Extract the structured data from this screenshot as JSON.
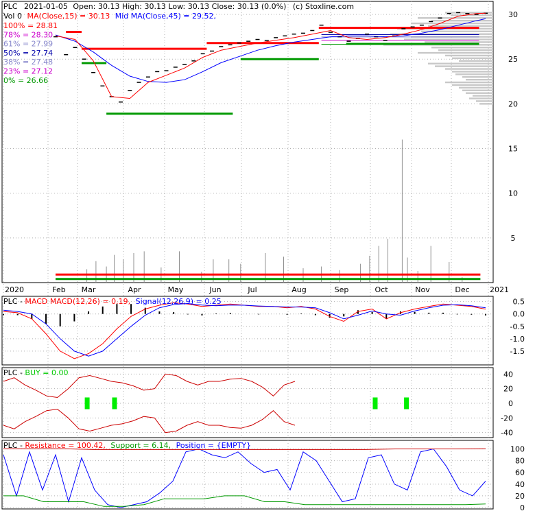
{
  "header": {
    "symbol": "PLC",
    "date": "2021-01-05",
    "ohlc_text": "Open: 30.13  High: 30.13  Low: 30.13  Close: 30.13 (0.0%)",
    "source": "(c) Stoxline.com"
  },
  "ma_legend": {
    "vol": "Vol 0",
    "ma15": "MA(Close,15) = 30.13",
    "ma45": "Mid MA(Close,45) = 29.52,"
  },
  "fib_levels": [
    {
      "label": "100% = 28.81",
      "color": "#ff0000"
    },
    {
      "label": "78% = 28.30",
      "color": "#cc00cc"
    },
    {
      "label": "61% = 27.99",
      "color": "#8888cc"
    },
    {
      "label": "50% = 27.74",
      "color": "#0000aa"
    },
    {
      "label": "38% = 27.48",
      "color": "#8888cc"
    },
    {
      "label": "23% = 27.12",
      "color": "#cc00cc"
    },
    {
      "label": "0% = 26.66",
      "color": "#009900"
    }
  ],
  "colors": {
    "price": "#000000",
    "ma15": "#ff0000",
    "ma45": "#0000ff",
    "resistance": "#ff0000",
    "support": "#009900",
    "volume": "#909090",
    "grid": "#b0b0b0"
  },
  "panels": {
    "macd": {
      "symbol": "PLC",
      "name": "MACD",
      "macd_label": "MACD(12,26) = 0.19,",
      "signal_label": "Signal(12,26,9) = 0.25"
    },
    "buy": {
      "symbol": "PLC",
      "label": "BUY = 0.00"
    },
    "rsp": {
      "symbol": "PLC",
      "resistance_label": "Resistance = 100.42,",
      "support_label": "Support = 6.14,",
      "position_label": "Position = {EMPTY}"
    }
  },
  "chart_data": [
    {
      "type": "line",
      "title": "PLC 2021-01-05 Open: 30.13 High: 30.13 Low: 30.13 Close: 30.13 (0.0%)",
      "x_ticks": [
        "2020",
        "Feb",
        "Mar",
        "Apr",
        "May",
        "Jun",
        "Jul",
        "Aug",
        "Sep",
        "Oct",
        "Nov",
        "Dec",
        "2021"
      ],
      "ylim": [
        0,
        31
      ],
      "y_ticks": [
        5,
        10,
        15,
        20,
        25,
        30
      ],
      "series": [
        {
          "name": "Close",
          "x": [
            "Feb 10",
            "Feb 18",
            "Feb 25",
            "Mar 3",
            "Mar 10",
            "Mar 17",
            "Mar 24",
            "Mar 31",
            "Apr 7",
            "Apr 14",
            "Apr 21",
            "Apr 28",
            "May 5",
            "May 12",
            "May 19",
            "May 26",
            "Jun 2",
            "Jun 9",
            "Jun 16",
            "Jun 23",
            "Jun 30",
            "Jul 7",
            "Jul 14",
            "Jul 21",
            "Jul 28",
            "Aug 4",
            "Aug 11",
            "Aug 18",
            "Aug 25",
            "Sep 1",
            "Sep 8",
            "Sep 15",
            "Sep 22",
            "Sep 29",
            "Oct 6",
            "Oct 13",
            "Oct 20",
            "Oct 27",
            "Nov 3",
            "Nov 10",
            "Nov 17",
            "Nov 24",
            "Dec 1",
            "Dec 8",
            "Dec 15",
            "Dec 22",
            "Dec 29",
            "Jan 5"
          ],
          "values": [
            27.5,
            25.5,
            26.3,
            25.0,
            23.5,
            22.0,
            20.8,
            20.2,
            21.5,
            22.4,
            23.0,
            23.6,
            23.7,
            24.1,
            24.4,
            24.8,
            25.6,
            25.9,
            26.4,
            26.6,
            26.8,
            27.0,
            27.2,
            27.1,
            27.4,
            27.6,
            27.8,
            27.9,
            28.2,
            28.8,
            28.0,
            27.5,
            27.0,
            27.3,
            27.8,
            27.5,
            27.1,
            27.6,
            28.4,
            28.6,
            28.8,
            29.2,
            29.6,
            30.1,
            30.2,
            30.1,
            30.0,
            30.13
          ]
        },
        {
          "name": "MA(Close,15)",
          "x": [
            "Feb 10",
            "Feb 25",
            "Mar 10",
            "Mar 24",
            "Apr 7",
            "Apr 21",
            "May 5",
            "May 19",
            "Jun 2",
            "Jun 16",
            "Jun 30",
            "Jul 14",
            "Jul 28",
            "Aug 11",
            "Aug 25",
            "Sep 8",
            "Sep 22",
            "Oct 6",
            "Oct 20",
            "Nov 3",
            "Nov 17",
            "Dec 1",
            "Dec 15",
            "Dec 29",
            "Jan 5"
          ],
          "values": [
            27.6,
            27.2,
            24.8,
            20.8,
            20.6,
            22.4,
            23.2,
            24.0,
            25.2,
            26.0,
            26.4,
            26.8,
            27.1,
            27.4,
            27.8,
            28.2,
            27.4,
            27.2,
            27.4,
            27.8,
            28.3,
            29.0,
            29.8,
            30.1,
            30.13
          ]
        },
        {
          "name": "Mid MA(Close,45)",
          "x": [
            "Feb 10",
            "Feb 25",
            "Mar 10",
            "Mar 24",
            "Apr 7",
            "Apr 21",
            "May 5",
            "May 19",
            "Jun 2",
            "Jun 16",
            "Jun 30",
            "Jul 14",
            "Jul 28",
            "Aug 11",
            "Aug 25",
            "Sep 8",
            "Sep 22",
            "Oct 6",
            "Oct 20",
            "Nov 3",
            "Nov 17",
            "Dec 1",
            "Dec 15",
            "Dec 29",
            "Jan 5"
          ],
          "values": [
            27.7,
            27.0,
            25.8,
            24.3,
            23.1,
            22.5,
            22.4,
            22.7,
            23.6,
            24.6,
            25.3,
            26.0,
            26.5,
            26.9,
            27.2,
            27.5,
            27.6,
            27.6,
            27.5,
            27.6,
            27.9,
            28.3,
            28.8,
            29.3,
            29.52
          ]
        },
        {
          "name": "Volume",
          "x": [
            "Mar 5",
            "Mar 12",
            "Mar 20",
            "Mar 26",
            "Apr 2",
            "Apr 10",
            "Apr 18",
            "May 1",
            "May 15",
            "Jun 1",
            "Jun 10",
            "Jun 22",
            "Jul 1",
            "Jul 20",
            "Aug 3",
            "Aug 18",
            "Sep 1",
            "Sep 15",
            "Oct 1",
            "Oct 8",
            "Oct 15",
            "Oct 22",
            "Nov 2",
            "Nov 6",
            "Nov 14",
            "Nov 24",
            "Dec 8",
            "Dec 18"
          ],
          "values": [
            1.5,
            2.4,
            1.8,
            3.1,
            2.6,
            3.3,
            3.5,
            1.7,
            3.5,
            1.2,
            2.6,
            2.6,
            2.1,
            3.3,
            2.9,
            1.6,
            1.8,
            1.4,
            2.1,
            3.0,
            4.1,
            4.9,
            16.0,
            2.8,
            1.3,
            4.1,
            2.3,
            0.6
          ]
        }
      ]
    },
    {
      "type": "line",
      "title": "PLC - MACD MACD(12,26) = 0.19, Signal(12,26,9) = 0.25",
      "ylim": [
        -2.0,
        0.6
      ],
      "y_ticks": [
        0.5,
        0.0,
        -0.5,
        -1.0,
        -1.5
      ],
      "series": [
        {
          "name": "MACD(12,26)",
          "values": [
            0.1,
            0.05,
            -0.2,
            -0.8,
            -1.5,
            -1.8,
            -1.6,
            -1.2,
            -0.6,
            -0.1,
            0.2,
            0.35,
            0.45,
            0.4,
            0.3,
            0.35,
            0.4,
            0.35,
            0.3,
            0.3,
            0.25,
            0.3,
            0.2,
            -0.1,
            -0.3,
            0.1,
            0.2,
            -0.2,
            0.05,
            0.2,
            0.3,
            0.4,
            0.35,
            0.3,
            0.19
          ]
        },
        {
          "name": "Signal(12,26,9)",
          "values": [
            0.15,
            0.1,
            0.0,
            -0.4,
            -1.0,
            -1.5,
            -1.7,
            -1.5,
            -1.0,
            -0.5,
            -0.05,
            0.25,
            0.38,
            0.42,
            0.36,
            0.33,
            0.36,
            0.35,
            0.32,
            0.3,
            0.28,
            0.28,
            0.25,
            0.05,
            -0.2,
            -0.05,
            0.12,
            0.0,
            -0.05,
            0.12,
            0.25,
            0.35,
            0.37,
            0.33,
            0.25
          ]
        }
      ]
    },
    {
      "type": "line",
      "title": "PLC - BUY = 0.00",
      "ylim": [
        -45,
        45
      ],
      "y_ticks": [
        40,
        20,
        0,
        -20,
        -40
      ],
      "series": [
        {
          "name": "Upper",
          "values": [
            30,
            35,
            25,
            18,
            10,
            8,
            20,
            35,
            38,
            34,
            30,
            28,
            24,
            18,
            20,
            40,
            38,
            30,
            25,
            30,
            30,
            33,
            34,
            30,
            22,
            10,
            25,
            30
          ]
        },
        {
          "name": "Lower",
          "values": [
            -30,
            -35,
            -25,
            -18,
            -10,
            -8,
            -20,
            -35,
            -38,
            -34,
            -30,
            -28,
            -24,
            -18,
            -20,
            -40,
            -38,
            -30,
            -25,
            -30,
            -30,
            -33,
            -34,
            -30,
            -22,
            -10,
            -25,
            -30
          ]
        }
      ]
    },
    {
      "type": "line",
      "title": "PLC - Resistance = 100.42, Support = 6.14, Position = {EMPTY}",
      "ylim": [
        0,
        110
      ],
      "y_ticks": [
        100,
        80,
        60,
        40,
        20,
        0
      ],
      "series": [
        {
          "name": "Resistance",
          "values": [
            100.42
          ]
        },
        {
          "name": "Support",
          "values": [
            6.14
          ]
        },
        {
          "name": "Position",
          "values": []
        }
      ]
    }
  ]
}
